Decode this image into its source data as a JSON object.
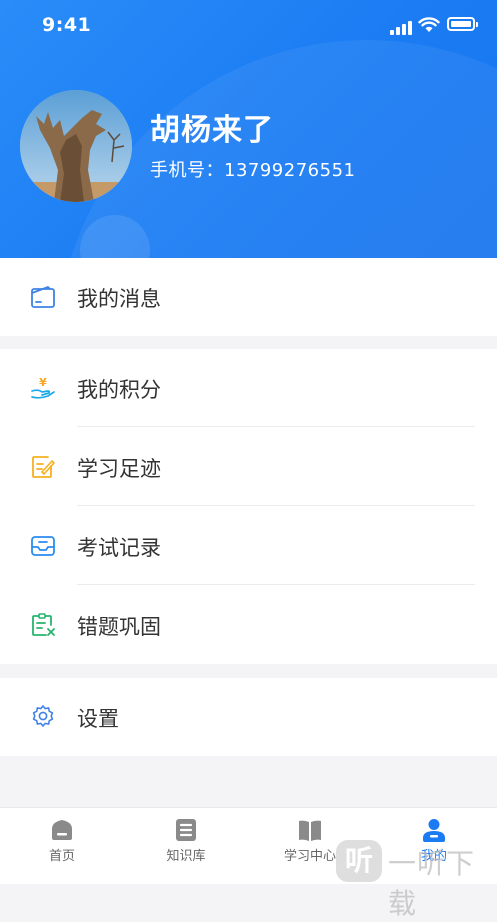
{
  "status_bar": {
    "time": "9:41"
  },
  "profile": {
    "name": "胡杨来了",
    "phone": "手机号：13799276551"
  },
  "menu": {
    "messages": "我的消息",
    "points": "我的积分",
    "footprints": "学习足迹",
    "exams": "考试记录",
    "mistakes": "错题巩固",
    "settings": "设置"
  },
  "tabs": {
    "home": "首页",
    "knowledge": "知识库",
    "learning": "学习中心",
    "mine": "我的",
    "active": "mine"
  },
  "watermark": {
    "icon_char": "听",
    "text": "一听下载"
  },
  "colors": {
    "primary": "#1a7bf3",
    "active_tab": "#1a7bf3",
    "inactive_tab": "#8a8a8a"
  }
}
